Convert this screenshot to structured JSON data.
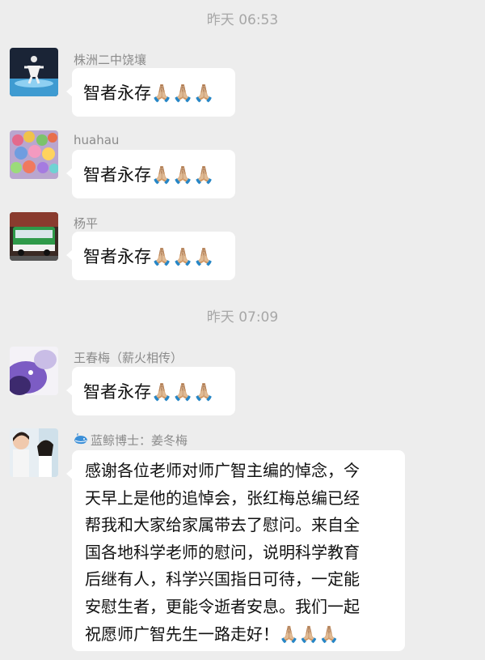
{
  "timestamps": [
    "昨天 06:53",
    "昨天 07:09"
  ],
  "messages": [
    {
      "sender": "株洲二中饶壤",
      "text": "智者永存🙏🏼🙏🏼🙏🏼",
      "avatar": "person-silhouette-avatar"
    },
    {
      "sender": "huahau",
      "text": "智者永存🙏🏼🙏🏼🙏🏼",
      "avatar": "candy-pile-avatar"
    },
    {
      "sender": "杨平",
      "text": "智者永存🙏🏼🙏🏼🙏🏼",
      "avatar": "green-bus-avatar"
    },
    {
      "sender": "王春梅（薪火相传）",
      "text": "智者永存🙏🏼🙏🏼🙏🏼",
      "avatar": "purple-flower-avatar"
    },
    {
      "sender": "蓝鲸博士：姜冬梅",
      "sender_icon": "whale-icon",
      "avatar": "woman-photo-avatar",
      "lines": [
        "感谢各位老师对师广智主编的悼念，今",
        "天早上是他的追悼会，张红梅总编已经",
        "帮我和大家给家属带去了慰问。来自全",
        "国各地科学老师的慰问，说明科学教育",
        "后继有人，科学兴国指日可待，一定能",
        "安慰生者，更能令逝者安息。我们一起",
        "祝愿师广智先生一路走好！🙏🏼🙏🏼🙏🏼"
      ]
    }
  ]
}
